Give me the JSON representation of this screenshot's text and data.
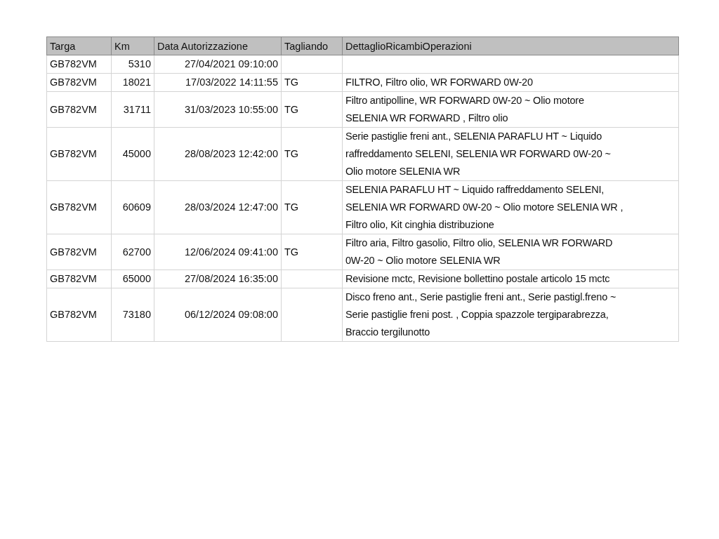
{
  "table": {
    "columns": [
      "Targa",
      "Km",
      "Data Autorizzazione",
      "Tagliando",
      "DettaglioRicambiOperazioni"
    ],
    "rows": [
      {
        "targa": "GB782VM",
        "km": "5310",
        "data": "27/04/2021 09:10:00",
        "tagliando": "",
        "dettaglio": ""
      },
      {
        "targa": "GB782VM",
        "km": "18021",
        "data": "17/03/2022 14:11:55",
        "tagliando": "TG",
        "dettaglio": "FILTRO, Filtro olio, WR FORWARD 0W-20"
      },
      {
        "targa": "GB782VM",
        "km": "31711",
        "data": "31/03/2023 10:55:00",
        "tagliando": "TG",
        "dettaglio": "Filtro antipolline, WR FORWARD 0W-20 ~ Olio motore\nSELENIA WR FORWARD , Filtro olio"
      },
      {
        "targa": "GB782VM",
        "km": "45000",
        "data": "28/08/2023 12:42:00",
        "tagliando": "TG",
        "dettaglio": "Serie pastiglie freni ant., SELENIA PARAFLU HT ~ Liquido\nraffreddamento SELENI, SELENIA WR FORWARD 0W-20 ~\nOlio motore SELENIA WR"
      },
      {
        "targa": "GB782VM",
        "km": "60609",
        "data": "28/03/2024 12:47:00",
        "tagliando": "TG",
        "dettaglio": "SELENIA PARAFLU HT ~ Liquido raffreddamento SELENI,\nSELENIA WR FORWARD 0W-20 ~ Olio motore SELENIA WR ,\nFiltro olio,  Kit cinghia distribuzione"
      },
      {
        "targa": "GB782VM",
        "km": "62700",
        "data": "12/06/2024 09:41:00",
        "tagliando": "TG",
        "dettaglio": "Filtro aria, Filtro gasolio, Filtro olio, SELENIA WR FORWARD\n0W-20 ~ Olio motore SELENIA WR"
      },
      {
        "targa": "GB782VM",
        "km": "65000",
        "data": "27/08/2024 16:35:00",
        "tagliando": "",
        "dettaglio": "Revisione mctc, Revisione bollettino postale articolo 15 mctc"
      },
      {
        "targa": "GB782VM",
        "km": "73180",
        "data": "06/12/2024 09:08:00",
        "tagliando": "",
        "dettaglio": "Disco freno ant., Serie pastiglie freni ant., Serie pastigl.freno ~\nSerie pastiglie freni post. , Coppia spazzole tergiparabrezza,\nBraccio tergilunotto"
      }
    ]
  }
}
